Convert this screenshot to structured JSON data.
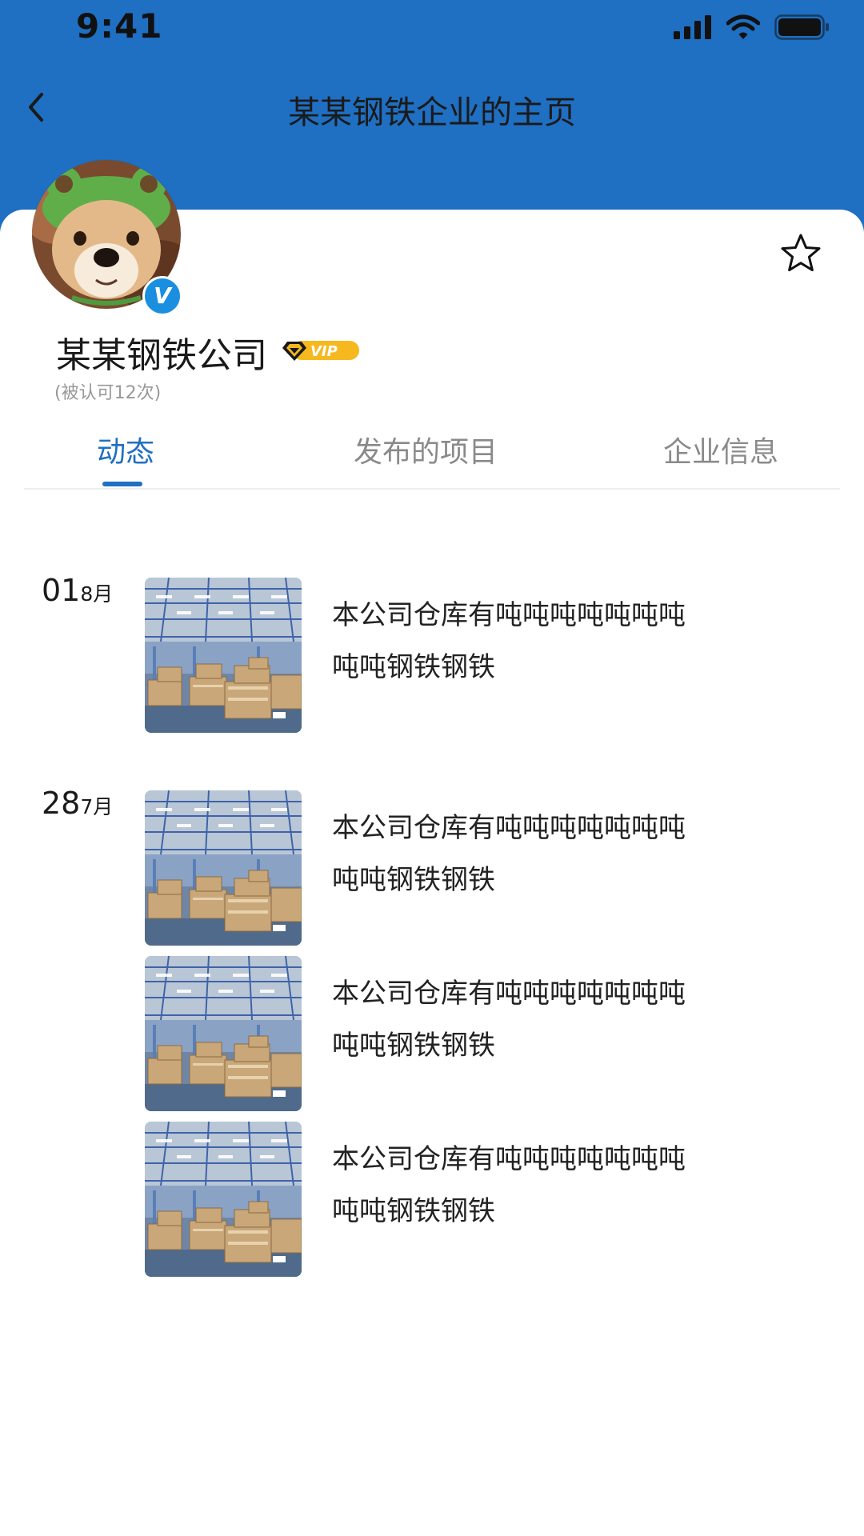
{
  "status_bar": {
    "time": "9:41"
  },
  "nav": {
    "title": "某某钢铁企业的主页"
  },
  "profile": {
    "company_name": "某某钢铁公司",
    "verified_badge": "V",
    "vip_label": "VIP",
    "recognized_text": "(被认可12次)"
  },
  "tabs": [
    {
      "label": "动态"
    },
    {
      "label": "发布的项目"
    },
    {
      "label": "企业信息"
    }
  ],
  "feed": {
    "groups": [
      {
        "day": "01",
        "month": "8月",
        "posts": [
          {
            "line1": "本公司仓库有吨吨吨吨吨吨吨",
            "line2": "吨吨钢铁钢铁"
          }
        ]
      },
      {
        "day": "28",
        "month": "7月",
        "posts": [
          {
            "line1": "本公司仓库有吨吨吨吨吨吨吨",
            "line2": "吨吨钢铁钢铁"
          },
          {
            "line1": "本公司仓库有吨吨吨吨吨吨吨",
            "line2": "吨吨钢铁钢铁"
          },
          {
            "line1": "本公司仓库有吨吨吨吨吨吨吨",
            "line2": "吨吨钢铁钢铁"
          }
        ]
      }
    ]
  },
  "colors": {
    "header_bg": "#1f6fc2",
    "accent": "#1f6fc2",
    "vip_gold": "#f5b91f",
    "verified_blue": "#1a8fe0"
  },
  "icons": {
    "back": "back-icon",
    "favorite": "star-icon",
    "signal": "signal-icon",
    "wifi": "wifi-icon",
    "battery": "battery-icon"
  }
}
